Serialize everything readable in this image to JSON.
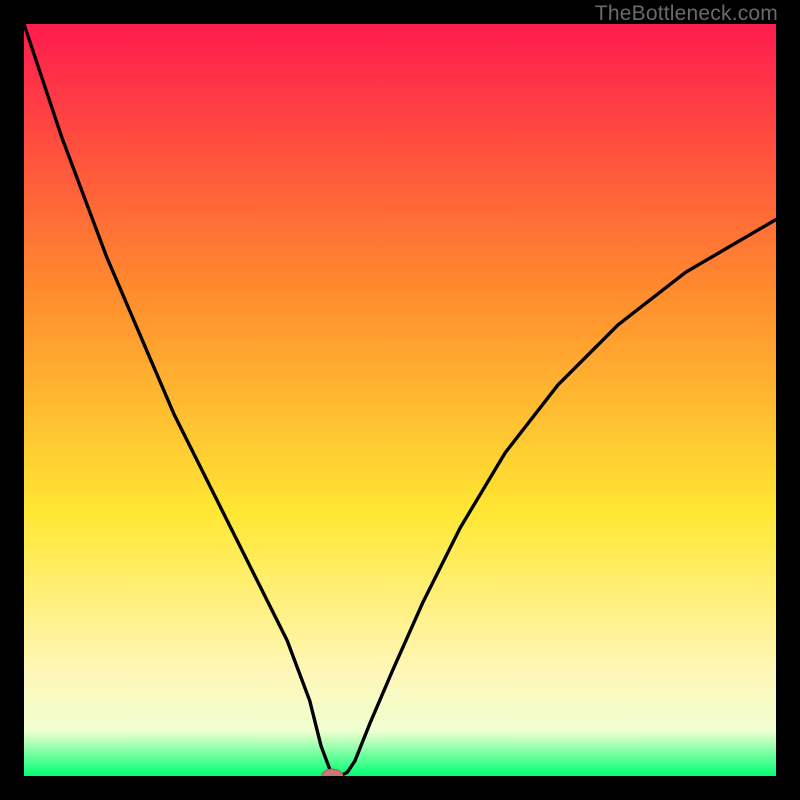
{
  "watermark": "TheBottleneck.com",
  "colors": {
    "frame": "#000000",
    "gradient_start": "#ff1b4e",
    "gradient_mid1": "#ff7a2e",
    "gradient_mid2": "#ffe733",
    "gradient_pale": "#fff9c7",
    "gradient_end": "#00ff73",
    "curve": "#000000",
    "marker_fill": "#c77a72",
    "marker_stroke": "#b26058"
  },
  "chart_data": {
    "type": "line",
    "title": "",
    "xlabel": "",
    "ylabel": "",
    "xlim": [
      0,
      100
    ],
    "ylim": [
      0,
      100
    ],
    "series": [
      {
        "name": "bottleneck-curve",
        "x": [
          0,
          2,
          5,
          8,
          11,
          14,
          17,
          20,
          23,
          26,
          29,
          32,
          35,
          38,
          39.5,
          41,
          42,
          43,
          44,
          46,
          49,
          53,
          58,
          64,
          71,
          79,
          88,
          100
        ],
        "y": [
          100,
          94,
          85,
          77,
          69,
          62,
          55,
          48,
          42,
          36,
          30,
          24,
          18,
          10,
          4,
          0,
          0,
          0.5,
          2,
          7,
          14,
          23,
          33,
          43,
          52,
          60,
          67,
          74
        ]
      }
    ],
    "marker": {
      "x": 41,
      "y": 0,
      "rx": 1.4,
      "ry": 0.9
    },
    "gradient_stops": [
      {
        "offset": 0,
        "color": "#ff1b4e"
      },
      {
        "offset": 35,
        "color": "#ff8a2e"
      },
      {
        "offset": 65,
        "color": "#ffe733"
      },
      {
        "offset": 86,
        "color": "#fff7b8"
      },
      {
        "offset": 94,
        "color": "#f0ffd0"
      },
      {
        "offset": 100,
        "color": "#00ff73"
      }
    ]
  }
}
